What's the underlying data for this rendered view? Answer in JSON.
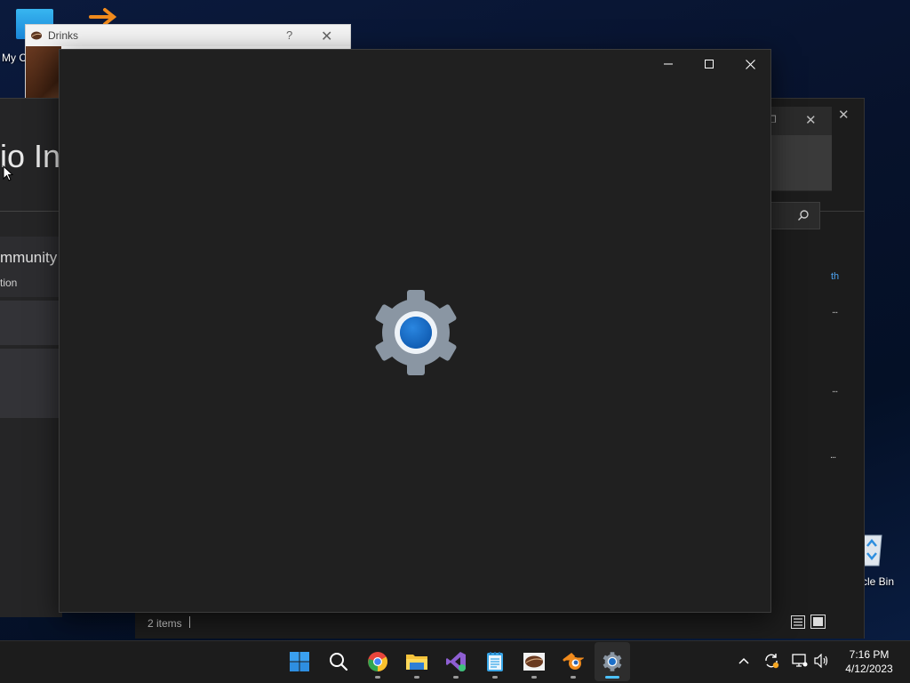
{
  "desktop": {
    "icons": [
      {
        "label": "My C",
        "icon": "computer-icon"
      },
      {
        "label": "cle Bin",
        "icon": "recycle-bin-icon"
      }
    ]
  },
  "drinks_window": {
    "title": "Drinks",
    "help": "?",
    "close": "✕"
  },
  "vs_installer_window": {
    "title_fragment": "io In",
    "card_title": "mmunity",
    "card_subtitle": "tion"
  },
  "explorer_window": {
    "link_fragment": "th",
    "more_glyph": "...",
    "status_items": "2 items",
    "close_glyph": "✕",
    "restore_glyph": "❐",
    "search_glyph": "⌕"
  },
  "settings_window": {
    "minimize": "—",
    "maximize": "☐",
    "close": "✕",
    "splash_icon": "settings-gear-icon"
  },
  "taskbar": {
    "apps": [
      {
        "name": "start",
        "icon": "windows-logo-icon"
      },
      {
        "name": "search",
        "icon": "search-icon"
      },
      {
        "name": "chrome",
        "icon": "chrome-icon"
      },
      {
        "name": "file-explorer",
        "icon": "folder-icon"
      },
      {
        "name": "visual-studio",
        "icon": "visual-studio-icon"
      },
      {
        "name": "notepad",
        "icon": "notepad-icon"
      },
      {
        "name": "drinks",
        "icon": "coffee-bean-icon"
      },
      {
        "name": "blender",
        "icon": "blender-icon"
      },
      {
        "name": "settings",
        "icon": "settings-gear-icon",
        "active": true
      }
    ],
    "tray": {
      "chevron": "^",
      "time": "7:16 PM",
      "date": "4/12/2023"
    }
  },
  "colors": {
    "accent": "#4cc2ff",
    "gear_blue": "#1b6fc9",
    "gear_gray": "#8a96a3",
    "window_bg": "#202020"
  }
}
